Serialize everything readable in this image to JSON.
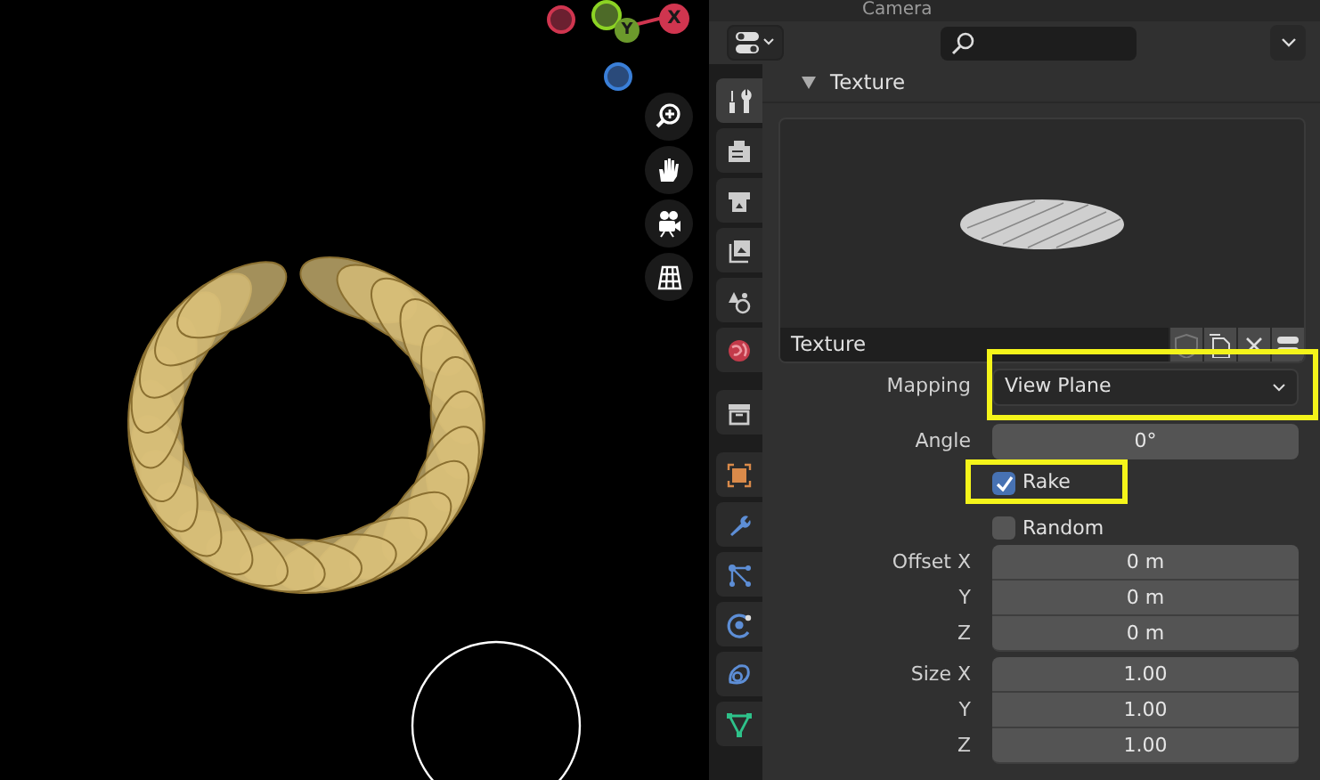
{
  "viewport": {
    "gizmo": {
      "y_label": "Y",
      "x_label": "X"
    }
  },
  "outliner": {
    "item": "Camera"
  },
  "properties": {
    "tabs": [
      {
        "kind": "tool",
        "selected": true
      },
      {
        "kind": "render",
        "selected": false
      },
      {
        "kind": "output",
        "selected": false
      },
      {
        "kind": "view-layer",
        "selected": false
      },
      {
        "kind": "scene",
        "selected": false
      },
      {
        "kind": "world",
        "selected": false
      },
      {
        "kind": "collection",
        "selected": false
      },
      {
        "kind": "object",
        "selected": false
      },
      {
        "kind": "modifier",
        "selected": false
      },
      {
        "kind": "particles",
        "selected": false
      },
      {
        "kind": "physics",
        "selected": false
      },
      {
        "kind": "constraints",
        "selected": false
      },
      {
        "kind": "data",
        "selected": false
      }
    ],
    "panel": {
      "title": "Texture",
      "expanded": true
    },
    "texture_name": "Texture",
    "mapping": {
      "label": "Mapping",
      "value": "View Plane"
    },
    "angle": {
      "label": "Angle",
      "value": "0°"
    },
    "checkboxes": [
      {
        "label": "Rake",
        "checked": true
      },
      {
        "label": "Random",
        "checked": false
      }
    ],
    "offset": [
      {
        "label": "Offset X",
        "value": "0 m"
      },
      {
        "label": "Y",
        "value": "0 m"
      },
      {
        "label": "Z",
        "value": "0 m"
      }
    ],
    "size": [
      {
        "label": "Size X",
        "value": "1.00"
      },
      {
        "label": "Y",
        "value": "1.00"
      },
      {
        "label": "Z",
        "value": "1.00"
      }
    ]
  }
}
